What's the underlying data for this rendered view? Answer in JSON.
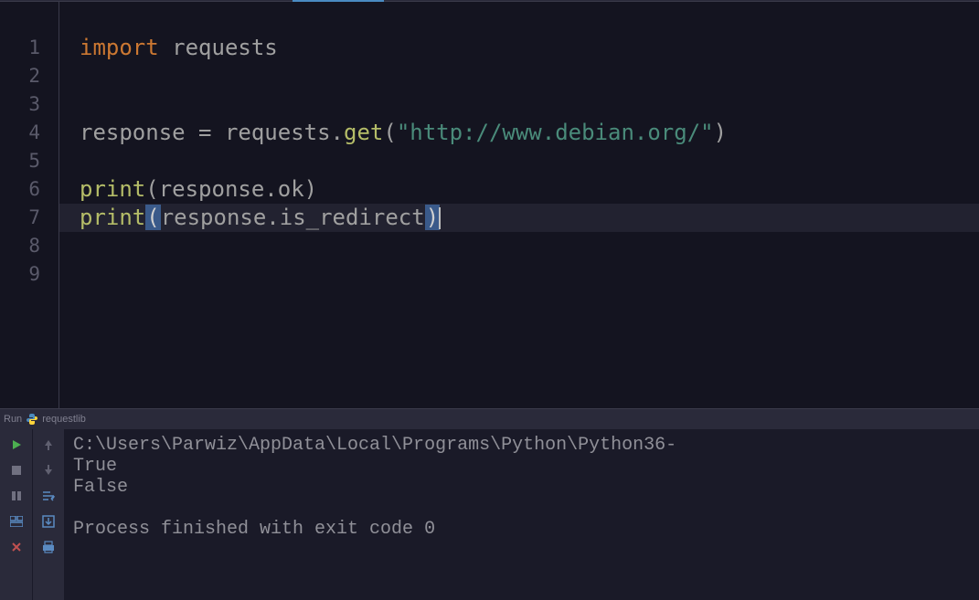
{
  "editor": {
    "line_numbers": [
      "1",
      "2",
      "3",
      "4",
      "5",
      "6",
      "7",
      "8",
      "9"
    ],
    "lines": {
      "l1": {
        "kw": "import",
        "mod": "requests"
      },
      "l4": {
        "var": "response",
        "op": "=",
        "mod": "requests",
        "method": "get",
        "str": "\"http://www.debian.org/\""
      },
      "l6": {
        "fn": "print",
        "var": "response",
        "attr": "ok"
      },
      "l7": {
        "fn": "print",
        "var": "response",
        "attr": "is_redirect"
      }
    }
  },
  "run_panel": {
    "label": "Run",
    "script_name": "requestlib",
    "output": {
      "path": "C:\\Users\\Parwiz\\AppData\\Local\\Programs\\Python\\Python36-",
      "line1": "True",
      "line2": "False",
      "exit": "Process finished with exit code 0"
    }
  }
}
